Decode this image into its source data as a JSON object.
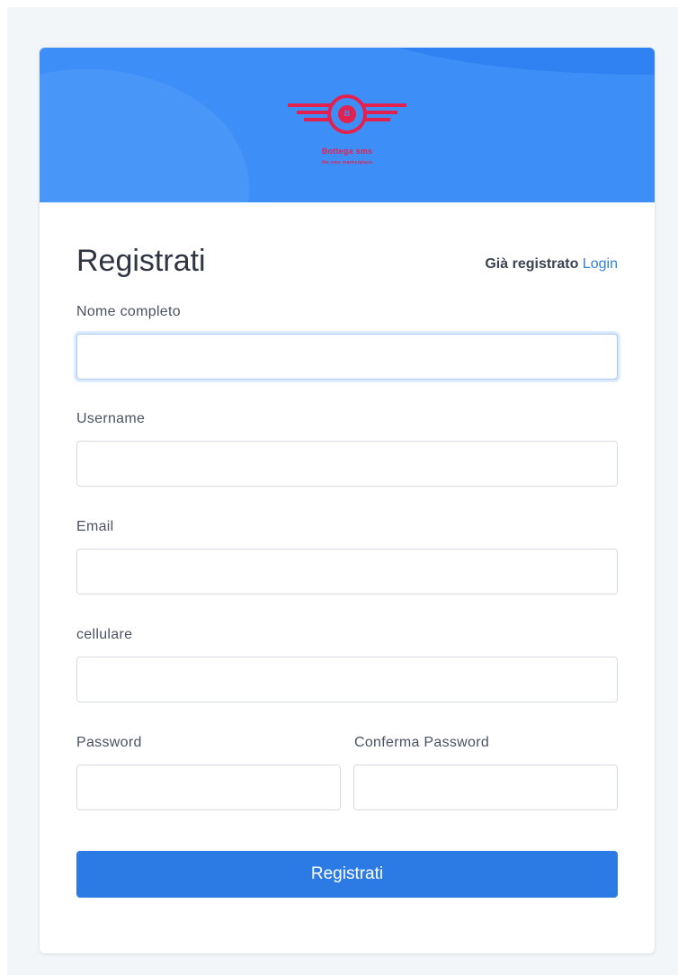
{
  "brand": {
    "name": "Bottega sms",
    "tagline": "the sms marketplace",
    "logo_letter": "B"
  },
  "form": {
    "title": "Registrati",
    "already_registered": "Già registrato",
    "login_link": "Login",
    "fields": {
      "full_name": {
        "label": "Nome completo",
        "value": ""
      },
      "username": {
        "label": "Username",
        "value": ""
      },
      "email": {
        "label": "Email",
        "value": ""
      },
      "phone": {
        "label": "cellulare",
        "value": ""
      },
      "password": {
        "label": "Password",
        "value": ""
      },
      "confirm_password": {
        "label": "Conferma Password",
        "value": ""
      }
    },
    "submit_label": "Registrati"
  },
  "colors": {
    "banner": "#3d8ff7",
    "logo": "#e3214f",
    "button": "#2c7be5",
    "link": "#2f7fe6"
  }
}
